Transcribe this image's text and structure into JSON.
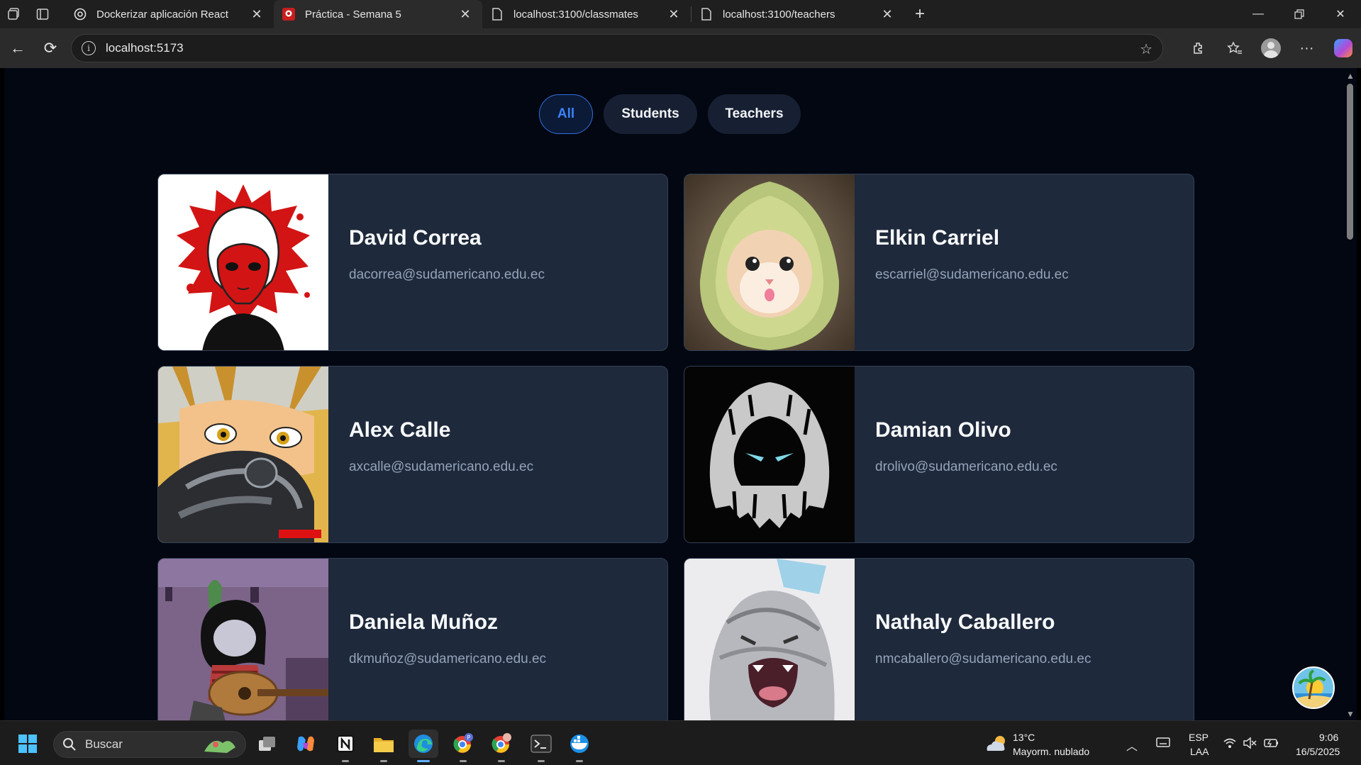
{
  "browser": {
    "tabs": [
      {
        "title": "Dockerizar aplicación React",
        "favicon": "openai-icon",
        "active": false
      },
      {
        "title": "Práctica - Semana 5",
        "favicon": "app-red-icon",
        "active": true
      },
      {
        "title": "localhost:3100/classmates",
        "favicon": "document-icon",
        "active": false
      },
      {
        "title": "localhost:3100/teachers",
        "favicon": "document-icon",
        "active": false
      }
    ],
    "url": "localhost:5173"
  },
  "filters": {
    "all": "All",
    "students": "Students",
    "teachers": "Teachers",
    "selected": "All"
  },
  "people": [
    {
      "name": "David Correa",
      "email": "dacorrea@sudamericano.edu.ec",
      "avatar": "red-anime-character"
    },
    {
      "name": "Elkin Carriel",
      "email": "escarriel@sudamericano.edu.ec",
      "avatar": "cat-in-avocado-costume"
    },
    {
      "name": "Alex Calle",
      "email": "axcalle@sudamericano.edu.ec",
      "avatar": "anime-character-with-glove"
    },
    {
      "name": "Damian Olivo",
      "email": "drolivo@sudamericano.edu.ec",
      "avatar": "moon-knight-logo"
    },
    {
      "name": "Daniela Muñoz",
      "email": "dkmuñoz@sudamericano.edu.ec",
      "avatar": "cartoon-girl-with-guitar"
    },
    {
      "name": "Nathaly Caballero",
      "email": "nmcaballero@sudamericano.edu.ec",
      "avatar": "screaming-cat"
    }
  ],
  "taskbar": {
    "search_label": "Buscar",
    "weather_temp": "13°C",
    "weather_desc": "Mayorm. nublado",
    "lang_top": "ESP",
    "lang_bottom": "LAA",
    "time": "9:06",
    "date": "16/5/2025"
  },
  "colors": {
    "page_bg": "#030712",
    "card_bg": "#1e293b",
    "accent": "#3b82f6"
  }
}
